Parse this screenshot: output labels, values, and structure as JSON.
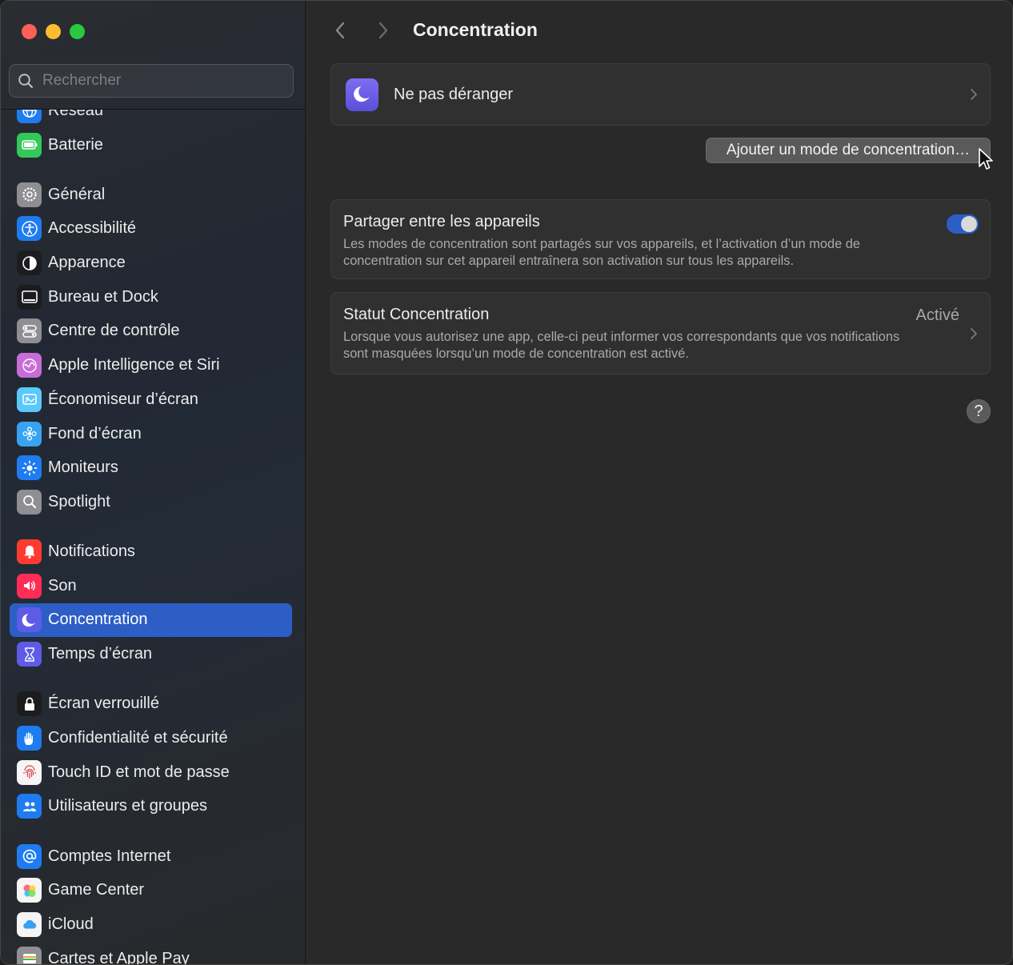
{
  "window": {
    "title": "Concentration"
  },
  "search": {
    "placeholder": "Rechercher",
    "value": ""
  },
  "sidebar": {
    "groups": [
      [
        {
          "label": "Réseau",
          "icon": "globe-icon",
          "color": "#1e7cf0"
        },
        {
          "label": "Batterie",
          "icon": "battery-icon",
          "color": "#34c759"
        }
      ],
      [
        {
          "label": "Général",
          "icon": "gear-icon",
          "color": "#8e8e93"
        },
        {
          "label": "Accessibilité",
          "icon": "accessibility-icon",
          "color": "#1e7cf0"
        },
        {
          "label": "Apparence",
          "icon": "appearance-icon",
          "color": "#1c1c1e"
        },
        {
          "label": "Bureau et Dock",
          "icon": "dock-icon",
          "color": "#1c1c1e"
        },
        {
          "label": "Centre de contrôle",
          "icon": "control-center-icon",
          "color": "#8e8e93"
        },
        {
          "label": "Apple Intelligence et Siri",
          "icon": "siri-icon",
          "color": "#c86dd7"
        },
        {
          "label": "Économiseur d’écran",
          "icon": "screensaver-icon",
          "color": "#5ac8fa"
        },
        {
          "label": "Fond d’écran",
          "icon": "wallpaper-icon",
          "color": "#38a3f1"
        },
        {
          "label": "Moniteurs",
          "icon": "displays-icon",
          "color": "#1e7cf0"
        },
        {
          "label": "Spotlight",
          "icon": "spotlight-icon",
          "color": "#8e8e93"
        }
      ],
      [
        {
          "label": "Notifications",
          "icon": "bell-icon",
          "color": "#ff3b30"
        },
        {
          "label": "Son",
          "icon": "speaker-icon",
          "color": "#ff2d55"
        },
        {
          "label": "Concentration",
          "icon": "moon-icon",
          "color": "#5e5ce6",
          "active": true
        },
        {
          "label": "Temps d’écran",
          "icon": "hourglass-icon",
          "color": "#5e5ce6"
        }
      ],
      [
        {
          "label": "Écran verrouillé",
          "icon": "lock-icon",
          "color": "#1c1c1e"
        },
        {
          "label": "Confidentialité et sécurité",
          "icon": "hand-icon",
          "color": "#1e7cf0"
        },
        {
          "label": "Touch ID et mot de passe",
          "icon": "fingerprint-icon",
          "color": "#f5f5f5"
        },
        {
          "label": "Utilisateurs et groupes",
          "icon": "users-icon",
          "color": "#1e7cf0"
        }
      ],
      [
        {
          "label": "Comptes Internet",
          "icon": "at-icon",
          "color": "#1e7cf0"
        },
        {
          "label": "Game Center",
          "icon": "game-center-icon",
          "color": "#f5f5f5"
        },
        {
          "label": "iCloud",
          "icon": "icloud-icon",
          "color": "#f5f5f5"
        },
        {
          "label": "Cartes et Apple Pay",
          "icon": "wallet-icon",
          "color": "#8e8e93"
        }
      ]
    ]
  },
  "main": {
    "title": "Concentration",
    "dnd": {
      "label": "Ne pas déranger",
      "icon": "moon-icon"
    },
    "add_mode_button": "Ajouter un mode de concentration…",
    "share": {
      "title": "Partager entre les appareils",
      "description": "Les modes de concentration sont partagés sur vos appareils, et l’activation d’un mode de concentration sur cet appareil entraînera son activation sur tous les appareils.",
      "enabled": true
    },
    "status": {
      "title": "Statut Concentration",
      "value": "Activé",
      "description": "Lorsque vous autorisez une app, celle-ci peut informer vos correspondants que vos notifications sont masquées lorsqu’un mode de concentration est activé."
    },
    "help_label": "?"
  },
  "colors": {
    "accent": "#2c5ec6",
    "moon_gradient_top": "#7d6ef2"
  }
}
